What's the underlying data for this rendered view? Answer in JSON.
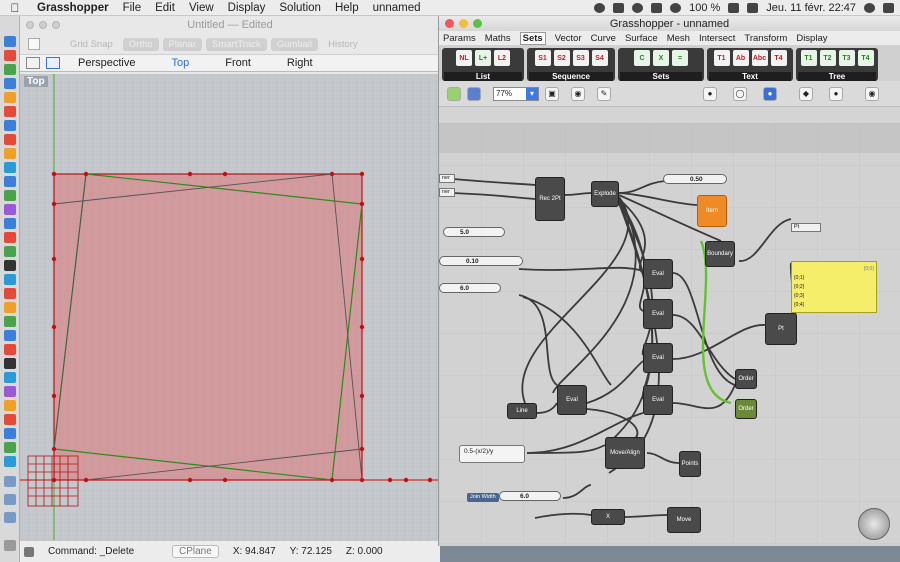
{
  "menubar": {
    "apple_icon": "apple-logo-icon",
    "items": [
      "Grasshopper",
      "File",
      "Edit",
      "View",
      "Display",
      "Solution",
      "Help",
      "unnamed"
    ],
    "battery": "100 %",
    "clock": "Jeu. 11 févr.  22:47"
  },
  "rhino": {
    "doc_title": "Untitled — Edited",
    "toolbar": [
      "Grid Snap",
      "Ortho",
      "Planar",
      "SmartTrack",
      "Gumball",
      "History"
    ],
    "view_tabs": [
      "Perspective",
      "Top",
      "Front",
      "Right"
    ],
    "active_view": "Top",
    "viewport_label": "Top",
    "status": {
      "command": "Command: _Delete",
      "cplane": "CPlane",
      "x": "X: 94.847",
      "y": "Y: 72.125",
      "z": "Z: 0.000"
    }
  },
  "grasshopper": {
    "title": "Grasshopper - unnamed",
    "tabs": [
      "Params",
      "Maths",
      "Sets",
      "Vector",
      "Curve",
      "Surface",
      "Mesh",
      "Intersect",
      "Transform",
      "Display"
    ],
    "active_tab": "Sets",
    "ribbon_groups": [
      {
        "label": "List",
        "icons": [
          "NL",
          "L+",
          "L2"
        ]
      },
      {
        "label": "Sequence",
        "icons": [
          "S1",
          "S2",
          "S3",
          "S4"
        ]
      },
      {
        "label": "Sets",
        "icons": [
          "C",
          "X",
          "="
        ]
      },
      {
        "label": "Text",
        "icons": [
          "T1",
          "Ab",
          "Abc",
          "T4"
        ]
      },
      {
        "label": "Tree",
        "icons": [
          "T1",
          "T2",
          "T3",
          "T4"
        ]
      }
    ],
    "zoom": "77%",
    "canvas": {
      "sliders": [
        {
          "label": "0.50",
          "name": "slider-0-50"
        },
        {
          "label": "5.0",
          "name": "slider-5-0"
        },
        {
          "label": "0.10",
          "name": "slider-0-10"
        },
        {
          "label": "6.0",
          "name": "slider-6-0"
        },
        {
          "label": "6.0",
          "name": "slider-join-width"
        }
      ],
      "param_stubs": [
        "Pt"
      ],
      "expression": "0.5-(x/2)/y",
      "join_width_label": "Join Width",
      "panel_lines": [
        "{0;0}",
        "{0;1}",
        "{0;2}",
        "{0;3}",
        "{0;4}"
      ],
      "panel_header": "{0;0}",
      "nodes": [
        "Rec 2Pt",
        "Explode",
        "Item",
        "Eval",
        "Eval",
        "Eval",
        "Eval",
        "Eval",
        "Eval",
        "Boundary",
        "Pt",
        "Order",
        "Order",
        "Move/Align",
        "Points",
        "Line",
        "Move",
        "X"
      ]
    }
  },
  "colors": {
    "rhino_bg": "#c5c9cd",
    "rect_fill": "#d48a8c",
    "curve_red": "#c01010",
    "curve_green": "#2e8a1a",
    "orange_node": "#f08a24",
    "panel_yellow": "#f4ee6a",
    "wire_green": "#66c033"
  }
}
